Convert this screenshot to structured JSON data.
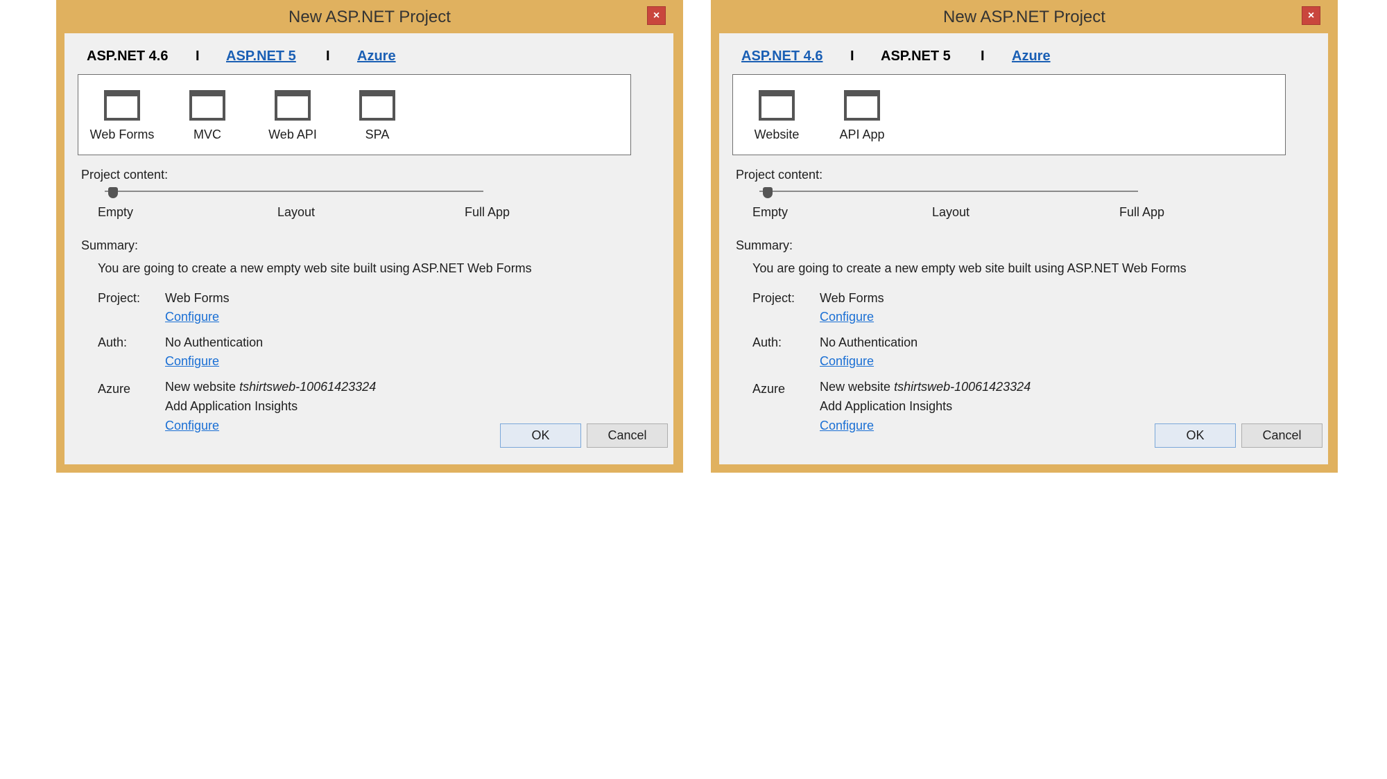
{
  "dialogs": [
    {
      "title": "New ASP.NET Project",
      "close": "×",
      "tabs": [
        {
          "label": "ASP.NET 4.6"
        },
        {
          "label": "ASP.NET 5"
        },
        {
          "label": "Azure"
        }
      ],
      "separator": "I",
      "templates": [
        {
          "label": "Web Forms"
        },
        {
          "label": "MVC"
        },
        {
          "label": "Web API"
        },
        {
          "label": "SPA"
        }
      ],
      "project_content_label": "Project content:",
      "slider_labels": [
        "Empty",
        "Layout",
        "Full App"
      ],
      "summary_label": "Summary:",
      "summary_text": "You are going to create a new empty web site built using ASP.NET Web Forms",
      "project_label": "Project:",
      "project_value": "Web Forms",
      "auth_label": "Auth:",
      "auth_value": "No Authentication",
      "azure_label": "Azure",
      "azure_new_website": "New website",
      "azure_site_name": "tshirtsweb-10061423324",
      "azure_insights": "Add Application Insights",
      "configure": "Configure",
      "ok": "OK",
      "cancel": "Cancel"
    },
    {
      "title": "New ASP.NET Project",
      "close": "×",
      "tabs": [
        {
          "label": "ASP.NET 4.6"
        },
        {
          "label": "ASP.NET 5"
        },
        {
          "label": "Azure"
        }
      ],
      "separator": "I",
      "templates": [
        {
          "label": "Website"
        },
        {
          "label": "API App"
        }
      ],
      "project_content_label": "Project content:",
      "slider_labels": [
        "Empty",
        "Layout",
        "Full App"
      ],
      "summary_label": "Summary:",
      "summary_text": "You are going to create a new empty web site built using ASP.NET Web Forms",
      "project_label": "Project:",
      "project_value": "Web Forms",
      "auth_label": "Auth:",
      "auth_value": "No Authentication",
      "azure_label": "Azure",
      "azure_new_website": "New website",
      "azure_site_name": "tshirtsweb-10061423324",
      "azure_insights": "Add Application Insights",
      "configure": "Configure",
      "ok": "OK",
      "cancel": "Cancel"
    }
  ]
}
